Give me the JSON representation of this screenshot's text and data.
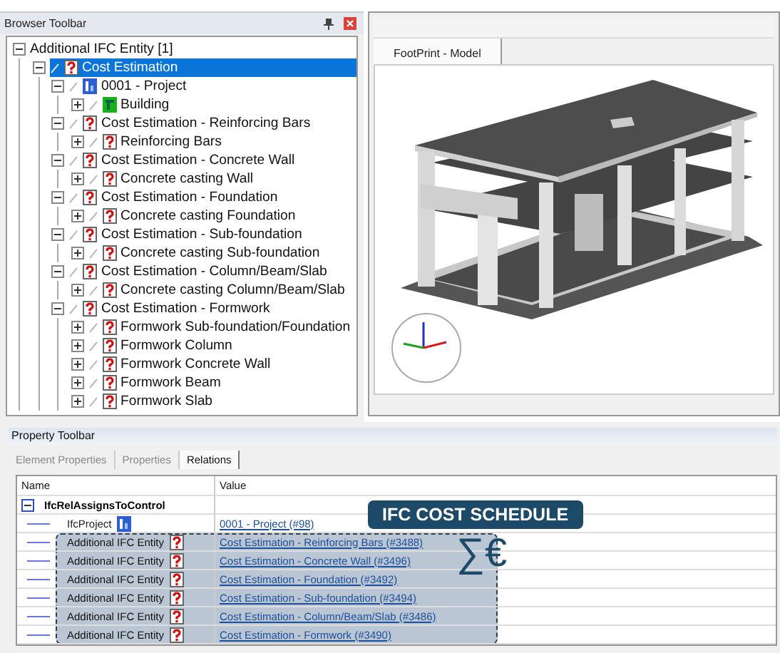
{
  "browser": {
    "title": "Browser Toolbar",
    "tree": [
      {
        "label": "Additional IFC Entity [1]",
        "kind": "root",
        "expanded": true,
        "selected": false,
        "children": [
          {
            "label": "Cost Estimation",
            "kind": "entity",
            "expanded": true,
            "selected": true,
            "children": [
              {
                "label": "0001 - Project",
                "kind": "project",
                "expanded": true,
                "selected": false,
                "children": [
                  {
                    "label": "Building",
                    "kind": "building",
                    "expanded": false,
                    "selected": false
                  }
                ]
              },
              {
                "label": "Cost Estimation - Reinforcing Bars",
                "kind": "entity",
                "expanded": true,
                "selected": false,
                "children": [
                  {
                    "label": "Reinforcing Bars",
                    "kind": "entity",
                    "expanded": false,
                    "selected": false
                  }
                ]
              },
              {
                "label": "Cost Estimation - Concrete Wall",
                "kind": "entity",
                "expanded": true,
                "selected": false,
                "children": [
                  {
                    "label": "Concrete casting Wall",
                    "kind": "entity",
                    "expanded": false,
                    "selected": false
                  }
                ]
              },
              {
                "label": "Cost Estimation - Foundation",
                "kind": "entity",
                "expanded": true,
                "selected": false,
                "children": [
                  {
                    "label": "Concrete casting Foundation",
                    "kind": "entity",
                    "expanded": false,
                    "selected": false
                  }
                ]
              },
              {
                "label": "Cost Estimation - Sub-foundation",
                "kind": "entity",
                "expanded": true,
                "selected": false,
                "children": [
                  {
                    "label": "Concrete casting Sub-foundation",
                    "kind": "entity",
                    "expanded": false,
                    "selected": false
                  }
                ]
              },
              {
                "label": "Cost Estimation - Column/Beam/Slab",
                "kind": "entity",
                "expanded": true,
                "selected": false,
                "children": [
                  {
                    "label": "Concrete casting Column/Beam/Slab",
                    "kind": "entity",
                    "expanded": false,
                    "selected": false
                  }
                ]
              },
              {
                "label": "Cost Estimation - Formwork",
                "kind": "entity",
                "expanded": true,
                "selected": false,
                "children": [
                  {
                    "label": "Formwork Sub-foundation/Foundation",
                    "kind": "entity",
                    "expanded": false,
                    "selected": false
                  },
                  {
                    "label": "Formwork Column",
                    "kind": "entity",
                    "expanded": false,
                    "selected": false
                  },
                  {
                    "label": "Formwork Concrete Wall",
                    "kind": "entity",
                    "expanded": false,
                    "selected": false
                  },
                  {
                    "label": "Formwork Beam",
                    "kind": "entity",
                    "expanded": false,
                    "selected": false
                  },
                  {
                    "label": "Formwork Slab",
                    "kind": "entity",
                    "expanded": false,
                    "selected": false
                  }
                ]
              }
            ]
          }
        ]
      }
    ]
  },
  "viewport": {
    "tabs": [
      "FootPrint - Model"
    ]
  },
  "property": {
    "title": "Property Toolbar",
    "tabs": [
      {
        "label": "Element Properties",
        "selected": false
      },
      {
        "label": "Properties",
        "selected": false
      },
      {
        "label": "Relations",
        "selected": true
      }
    ],
    "columns": [
      "Name",
      "Value"
    ],
    "rows": [
      {
        "kind": "group",
        "name": "IfcRelAssignsToControl",
        "expanded": true
      },
      {
        "kind": "project",
        "name": "IfcProject",
        "value": "0001 - Project (#98)",
        "highlighted": false
      },
      {
        "kind": "entity",
        "name": "Additional IFC Entity",
        "value": "Cost Estimation - Reinforcing Bars (#3488)",
        "highlighted": true
      },
      {
        "kind": "entity",
        "name": "Additional IFC Entity",
        "value": "Cost Estimation - Concrete Wall (#3496)",
        "highlighted": true
      },
      {
        "kind": "entity",
        "name": "Additional IFC Entity",
        "value": "Cost Estimation - Foundation (#3492)",
        "highlighted": true
      },
      {
        "kind": "entity",
        "name": "Additional IFC Entity",
        "value": "Cost Estimation - Sub-foundation (#3494)",
        "highlighted": true
      },
      {
        "kind": "entity",
        "name": "Additional IFC Entity",
        "value": "Cost Estimation - Column/Beam/Slab (#3486)",
        "highlighted": true
      },
      {
        "kind": "entity",
        "name": "Additional IFC Entity",
        "value": "Cost Estimation - Formwork (#3490)",
        "highlighted": true
      }
    ]
  },
  "callout": {
    "title": "IFC COST SCHEDULE",
    "symbol": "∑€"
  }
}
